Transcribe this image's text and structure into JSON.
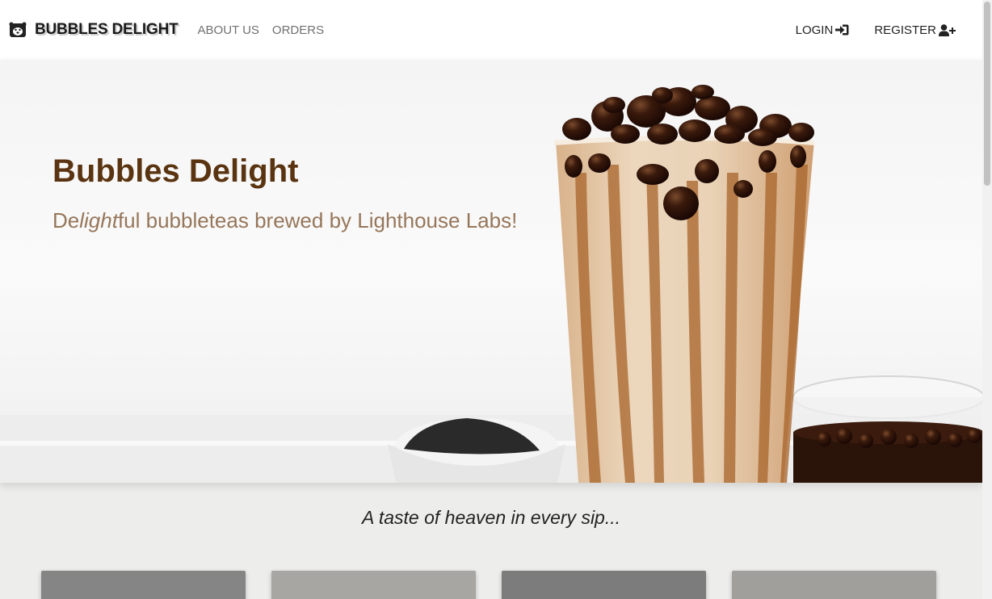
{
  "navbar": {
    "brand": "BUBBLES DELIGHT",
    "links": [
      "ABOUT US",
      "ORDERS"
    ],
    "login_label": "LOGIN",
    "register_label": "REGISTER"
  },
  "hero": {
    "title": "Bubbles Delight",
    "subtitle_prefix": "De",
    "subtitle_italic": "light",
    "subtitle_suffix": "ful bubbleteas brewed by Lighthouse Labs!"
  },
  "tagline": "A taste of heaven in every sip...",
  "icons": {
    "brand": "bear-icon",
    "login": "sign-in-icon",
    "register": "user-plus-icon"
  },
  "colors": {
    "title": "#5a3410",
    "subtitle": "#96765a",
    "tea": "#e2c7a4",
    "tapioca": "#2b130a"
  },
  "cards": [
    {
      "color": "#858585"
    },
    {
      "color": "#a8a6a2"
    },
    {
      "color": "#7c7c7c"
    },
    {
      "color": "#a19f9b"
    }
  ]
}
